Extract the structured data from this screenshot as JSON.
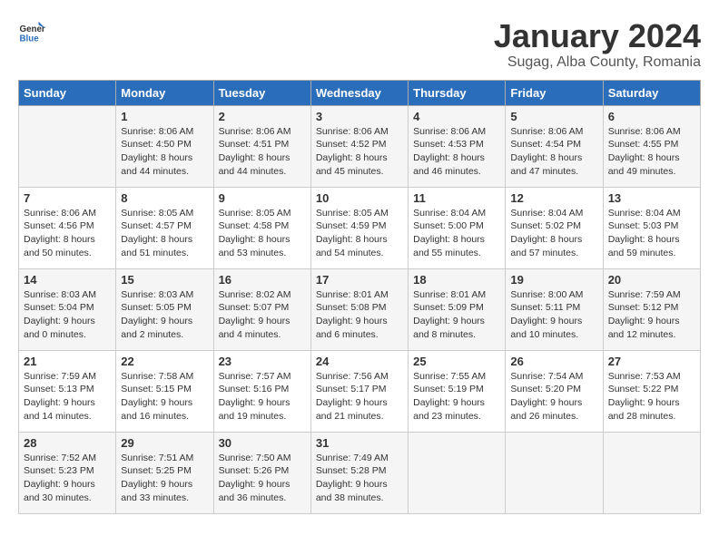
{
  "header": {
    "logo_general": "General",
    "logo_blue": "Blue",
    "month_title": "January 2024",
    "location": "Sugag, Alba County, Romania"
  },
  "weekdays": [
    "Sunday",
    "Monday",
    "Tuesday",
    "Wednesday",
    "Thursday",
    "Friday",
    "Saturday"
  ],
  "weeks": [
    [
      {
        "day": "",
        "info": ""
      },
      {
        "day": "1",
        "info": "Sunrise: 8:06 AM\nSunset: 4:50 PM\nDaylight: 8 hours\nand 44 minutes."
      },
      {
        "day": "2",
        "info": "Sunrise: 8:06 AM\nSunset: 4:51 PM\nDaylight: 8 hours\nand 44 minutes."
      },
      {
        "day": "3",
        "info": "Sunrise: 8:06 AM\nSunset: 4:52 PM\nDaylight: 8 hours\nand 45 minutes."
      },
      {
        "day": "4",
        "info": "Sunrise: 8:06 AM\nSunset: 4:53 PM\nDaylight: 8 hours\nand 46 minutes."
      },
      {
        "day": "5",
        "info": "Sunrise: 8:06 AM\nSunset: 4:54 PM\nDaylight: 8 hours\nand 47 minutes."
      },
      {
        "day": "6",
        "info": "Sunrise: 8:06 AM\nSunset: 4:55 PM\nDaylight: 8 hours\nand 49 minutes."
      }
    ],
    [
      {
        "day": "7",
        "info": "Sunrise: 8:06 AM\nSunset: 4:56 PM\nDaylight: 8 hours\nand 50 minutes."
      },
      {
        "day": "8",
        "info": "Sunrise: 8:05 AM\nSunset: 4:57 PM\nDaylight: 8 hours\nand 51 minutes."
      },
      {
        "day": "9",
        "info": "Sunrise: 8:05 AM\nSunset: 4:58 PM\nDaylight: 8 hours\nand 53 minutes."
      },
      {
        "day": "10",
        "info": "Sunrise: 8:05 AM\nSunset: 4:59 PM\nDaylight: 8 hours\nand 54 minutes."
      },
      {
        "day": "11",
        "info": "Sunrise: 8:04 AM\nSunset: 5:00 PM\nDaylight: 8 hours\nand 55 minutes."
      },
      {
        "day": "12",
        "info": "Sunrise: 8:04 AM\nSunset: 5:02 PM\nDaylight: 8 hours\nand 57 minutes."
      },
      {
        "day": "13",
        "info": "Sunrise: 8:04 AM\nSunset: 5:03 PM\nDaylight: 8 hours\nand 59 minutes."
      }
    ],
    [
      {
        "day": "14",
        "info": "Sunrise: 8:03 AM\nSunset: 5:04 PM\nDaylight: 9 hours\nand 0 minutes."
      },
      {
        "day": "15",
        "info": "Sunrise: 8:03 AM\nSunset: 5:05 PM\nDaylight: 9 hours\nand 2 minutes."
      },
      {
        "day": "16",
        "info": "Sunrise: 8:02 AM\nSunset: 5:07 PM\nDaylight: 9 hours\nand 4 minutes."
      },
      {
        "day": "17",
        "info": "Sunrise: 8:01 AM\nSunset: 5:08 PM\nDaylight: 9 hours\nand 6 minutes."
      },
      {
        "day": "18",
        "info": "Sunrise: 8:01 AM\nSunset: 5:09 PM\nDaylight: 9 hours\nand 8 minutes."
      },
      {
        "day": "19",
        "info": "Sunrise: 8:00 AM\nSunset: 5:11 PM\nDaylight: 9 hours\nand 10 minutes."
      },
      {
        "day": "20",
        "info": "Sunrise: 7:59 AM\nSunset: 5:12 PM\nDaylight: 9 hours\nand 12 minutes."
      }
    ],
    [
      {
        "day": "21",
        "info": "Sunrise: 7:59 AM\nSunset: 5:13 PM\nDaylight: 9 hours\nand 14 minutes."
      },
      {
        "day": "22",
        "info": "Sunrise: 7:58 AM\nSunset: 5:15 PM\nDaylight: 9 hours\nand 16 minutes."
      },
      {
        "day": "23",
        "info": "Sunrise: 7:57 AM\nSunset: 5:16 PM\nDaylight: 9 hours\nand 19 minutes."
      },
      {
        "day": "24",
        "info": "Sunrise: 7:56 AM\nSunset: 5:17 PM\nDaylight: 9 hours\nand 21 minutes."
      },
      {
        "day": "25",
        "info": "Sunrise: 7:55 AM\nSunset: 5:19 PM\nDaylight: 9 hours\nand 23 minutes."
      },
      {
        "day": "26",
        "info": "Sunrise: 7:54 AM\nSunset: 5:20 PM\nDaylight: 9 hours\nand 26 minutes."
      },
      {
        "day": "27",
        "info": "Sunrise: 7:53 AM\nSunset: 5:22 PM\nDaylight: 9 hours\nand 28 minutes."
      }
    ],
    [
      {
        "day": "28",
        "info": "Sunrise: 7:52 AM\nSunset: 5:23 PM\nDaylight: 9 hours\nand 30 minutes."
      },
      {
        "day": "29",
        "info": "Sunrise: 7:51 AM\nSunset: 5:25 PM\nDaylight: 9 hours\nand 33 minutes."
      },
      {
        "day": "30",
        "info": "Sunrise: 7:50 AM\nSunset: 5:26 PM\nDaylight: 9 hours\nand 36 minutes."
      },
      {
        "day": "31",
        "info": "Sunrise: 7:49 AM\nSunset: 5:28 PM\nDaylight: 9 hours\nand 38 minutes."
      },
      {
        "day": "",
        "info": ""
      },
      {
        "day": "",
        "info": ""
      },
      {
        "day": "",
        "info": ""
      }
    ]
  ]
}
